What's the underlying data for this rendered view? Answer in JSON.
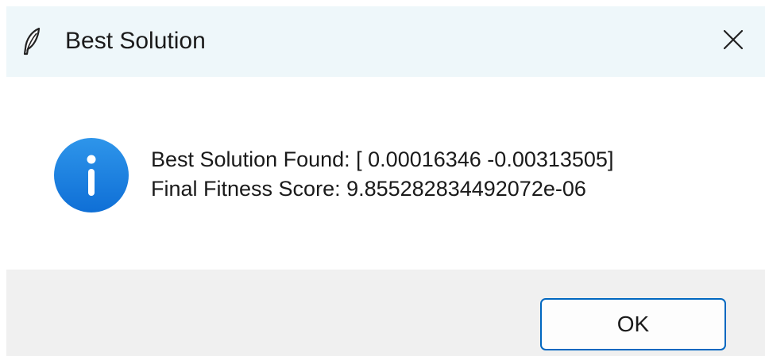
{
  "window": {
    "title": "Best Solution",
    "title_icon": "feather-icon",
    "close_icon": "close-icon"
  },
  "message": {
    "icon": "info-icon",
    "line1": "Best Solution Found: [ 0.00016346 -0.00313505]",
    "line2": "Final Fitness Score: 9.855282834492072e-06"
  },
  "footer": {
    "ok_label": "OK"
  },
  "colors": {
    "titlebar_bg": "#eef7fa",
    "footer_bg": "#f0f0f0",
    "accent": "#0067c0",
    "info_icon": "#1a7fe0"
  }
}
